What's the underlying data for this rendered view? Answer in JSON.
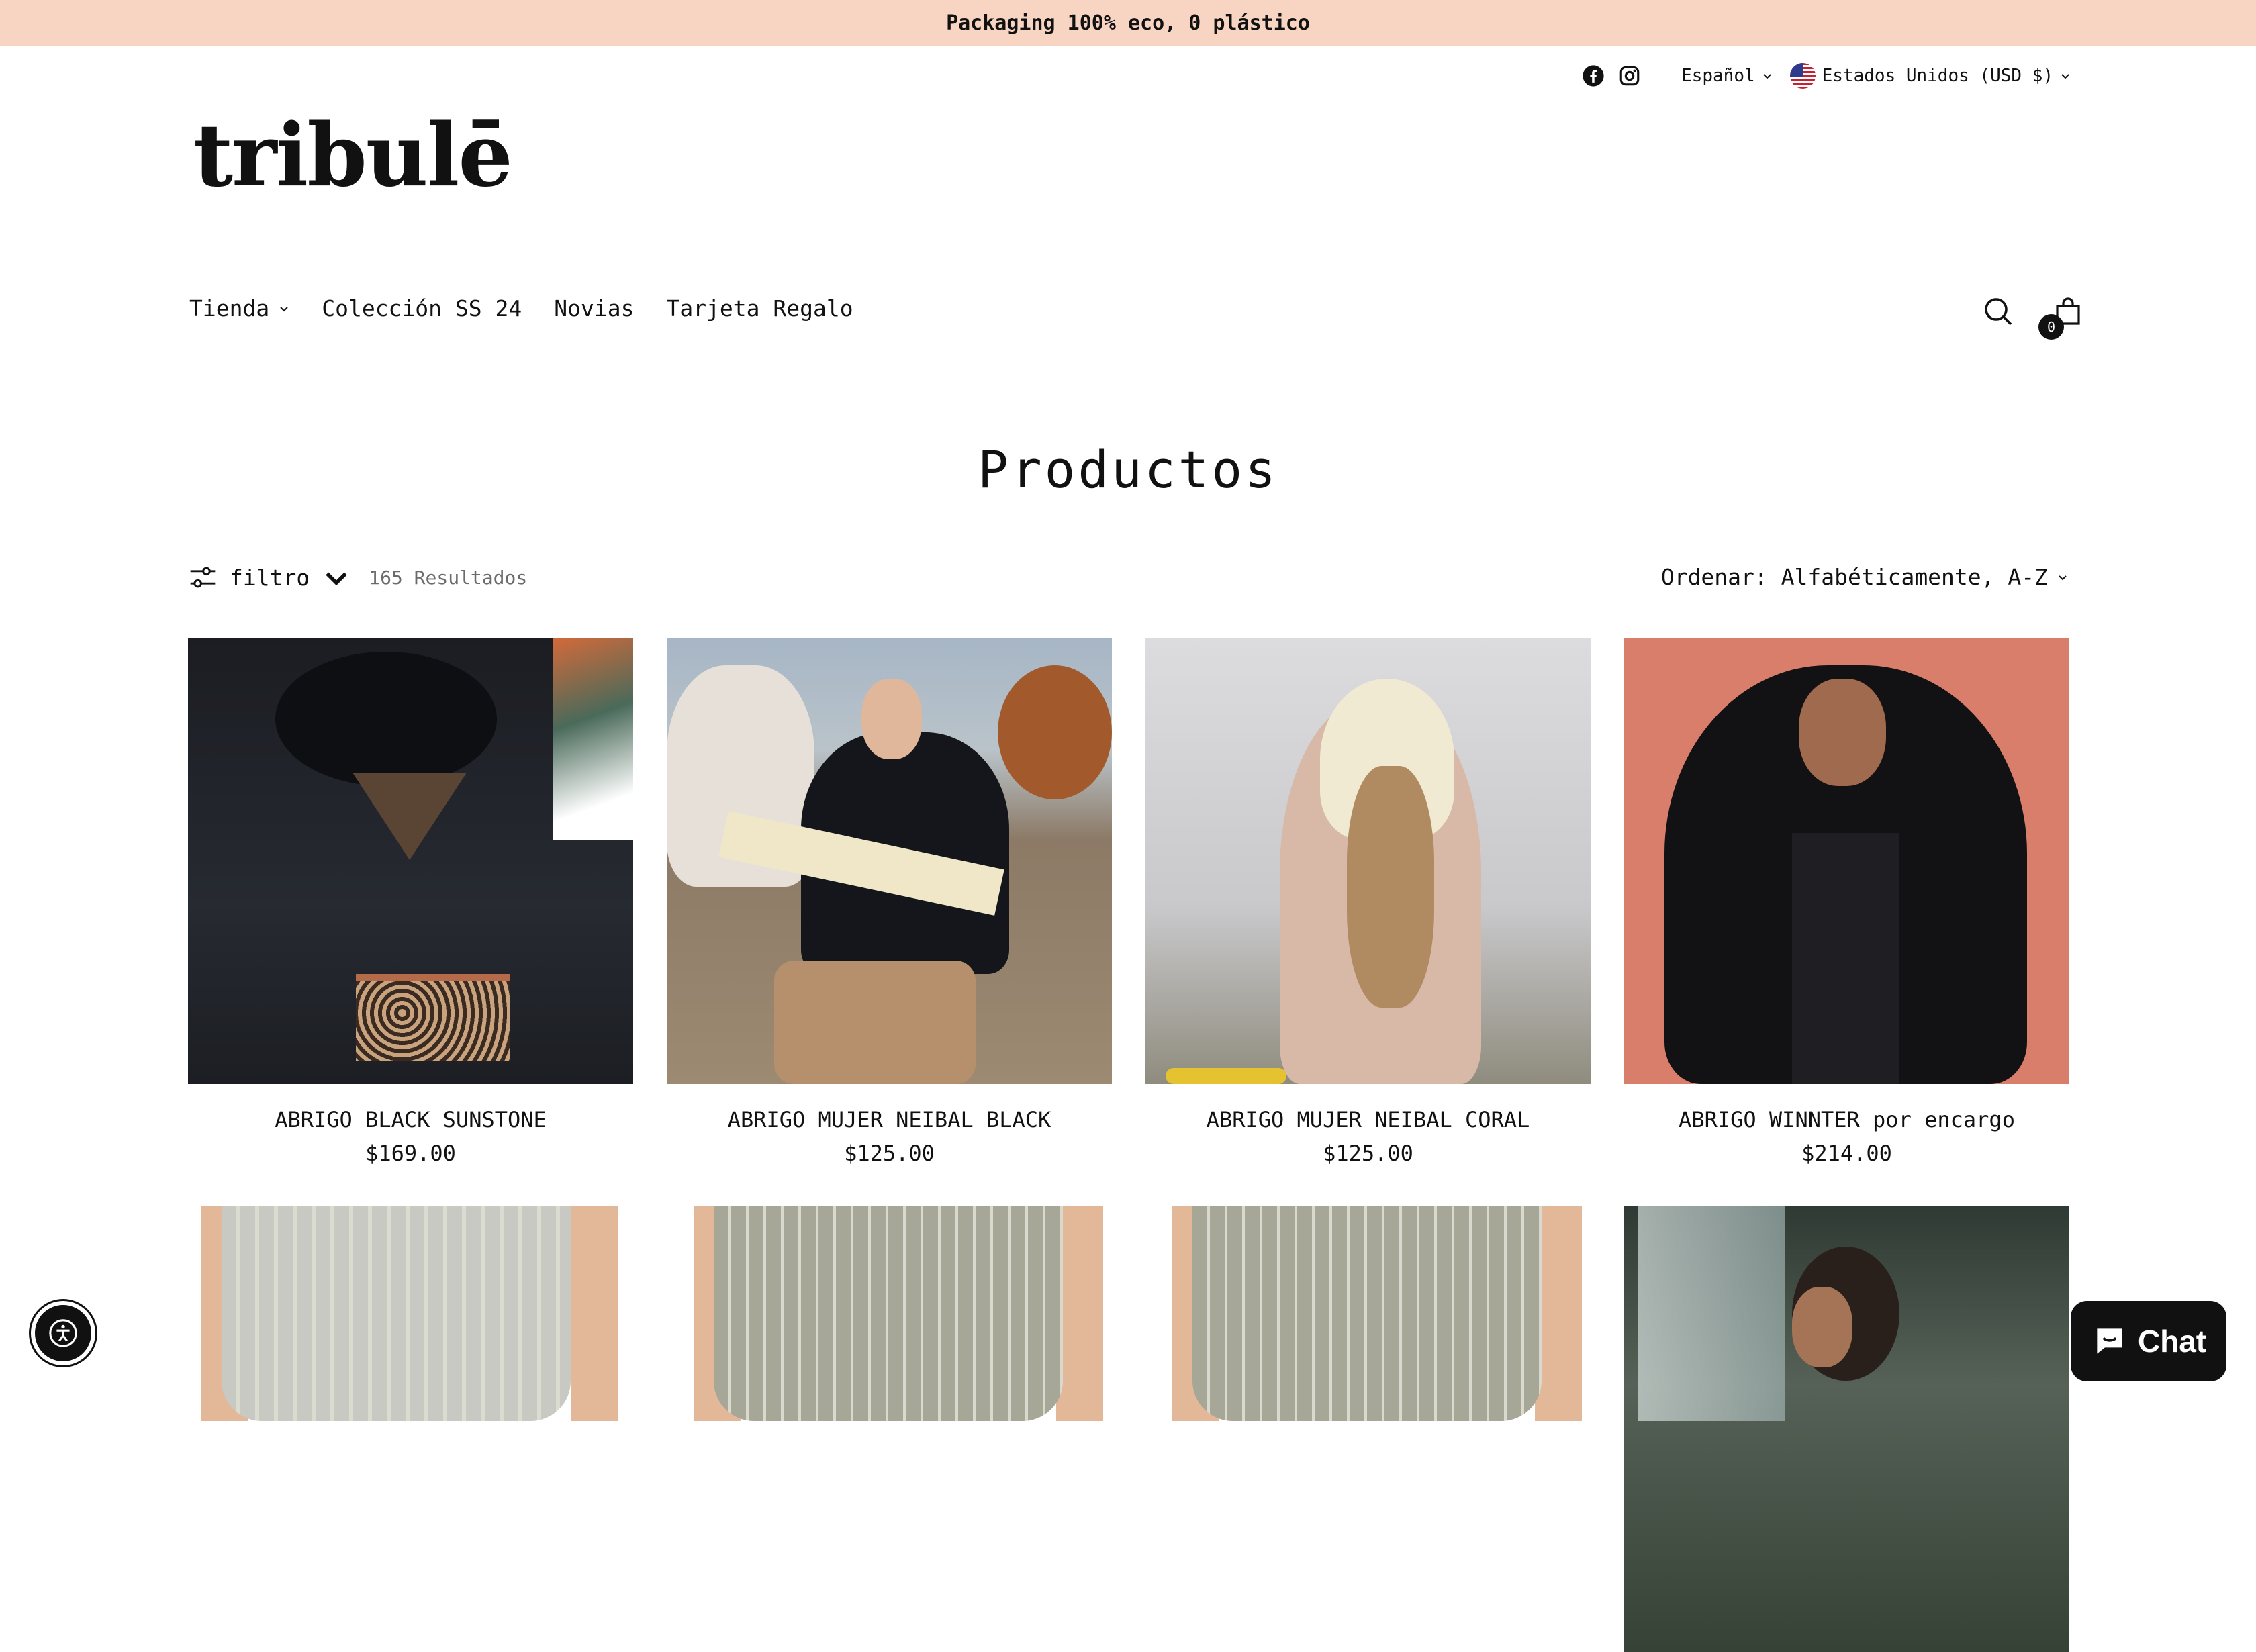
{
  "announcement": "Packaging 100% eco, 0 plástico",
  "utility": {
    "social_icons": [
      "facebook-icon",
      "instagram-icon"
    ],
    "language": "Español",
    "country": "Estados Unidos (USD $)"
  },
  "logo": "tribulē",
  "nav": {
    "items": [
      {
        "label": "Tienda",
        "has_dropdown": true
      },
      {
        "label": "Colección SS 24",
        "has_dropdown": false
      },
      {
        "label": "Novias",
        "has_dropdown": false
      },
      {
        "label": "Tarjeta Regalo",
        "has_dropdown": false
      }
    ],
    "cart_count": "0"
  },
  "page_title": "Productos",
  "toolbar": {
    "filter_label": "filtro",
    "results": "165 Resultados",
    "sort_label": "Ordenar: Alfabéticamente, A-Z"
  },
  "products": [
    {
      "name": "ABRIGO BLACK SUNSTONE",
      "price": "$169.00"
    },
    {
      "name": "ABRIGO MUJER NEIBAL BLACK",
      "price": "$125.00"
    },
    {
      "name": "ABRIGO MUJER NEIBAL CORAL",
      "price": "$125.00"
    },
    {
      "name": "ABRIGO WINNTER por encargo",
      "price": "$214.00"
    }
  ],
  "chat_label": "Chat",
  "colors": {
    "announcement_bg": "#f7d5c2",
    "text": "#111111",
    "muted": "#6b6b6b"
  }
}
